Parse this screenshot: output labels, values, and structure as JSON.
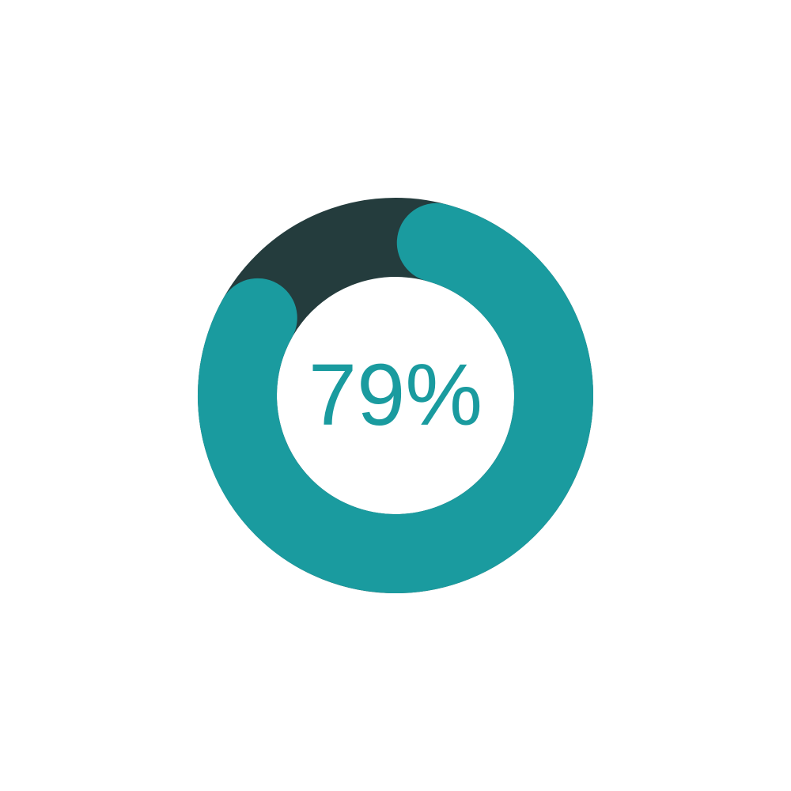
{
  "chart_data": {
    "type": "pie",
    "title": "",
    "value": 79,
    "max": 100,
    "label": "79%",
    "colors": {
      "progress": "#1a9b9f",
      "track": "#243c3d",
      "label": "#1a9b9f",
      "background": "#ffffff"
    }
  }
}
